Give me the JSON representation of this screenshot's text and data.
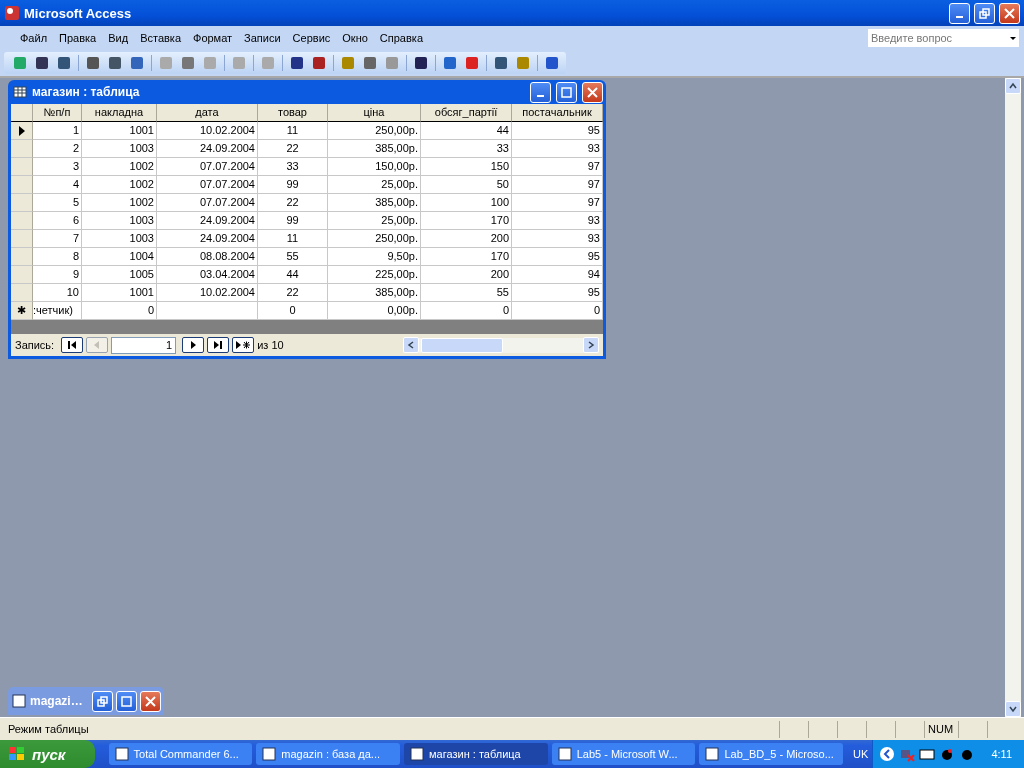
{
  "window": {
    "title": "Microsoft Access"
  },
  "menu": [
    {
      "label": "Файл"
    },
    {
      "label": "Правка"
    },
    {
      "label": "Вид"
    },
    {
      "label": "Вставка"
    },
    {
      "label": "Формат"
    },
    {
      "label": "Записи"
    },
    {
      "label": "Сервис"
    },
    {
      "label": "Окно"
    },
    {
      "label": "Справка"
    }
  ],
  "help_search": {
    "placeholder": "Введите вопрос"
  },
  "table_window": {
    "title": "магазин : таблица",
    "columns": [
      "№п/п",
      "накладна",
      "дата",
      "товар",
      "ціна",
      "обсяг_партії",
      "постачальник"
    ],
    "rows": [
      {
        "selected": true,
        "cells": [
          "1",
          "1001",
          "10.02.2004",
          "11",
          "250,00р.",
          "44",
          "95"
        ]
      },
      {
        "selected": false,
        "cells": [
          "2",
          "1003",
          "24.09.2004",
          "22",
          "385,00р.",
          "33",
          "93"
        ]
      },
      {
        "selected": false,
        "cells": [
          "3",
          "1002",
          "07.07.2004",
          "33",
          "150,00р.",
          "150",
          "97"
        ]
      },
      {
        "selected": false,
        "cells": [
          "4",
          "1002",
          "07.07.2004",
          "99",
          "25,00р.",
          "50",
          "97"
        ]
      },
      {
        "selected": false,
        "cells": [
          "5",
          "1002",
          "07.07.2004",
          "22",
          "385,00р.",
          "100",
          "97"
        ]
      },
      {
        "selected": false,
        "cells": [
          "6",
          "1003",
          "24.09.2004",
          "99",
          "25,00р.",
          "170",
          "93"
        ]
      },
      {
        "selected": false,
        "cells": [
          "7",
          "1003",
          "24.09.2004",
          "11",
          "250,00р.",
          "200",
          "93"
        ]
      },
      {
        "selected": false,
        "cells": [
          "8",
          "1004",
          "08.08.2004",
          "55",
          "9,50р.",
          "170",
          "95"
        ]
      },
      {
        "selected": false,
        "cells": [
          "9",
          "1005",
          "03.04.2004",
          "44",
          "225,00р.",
          "200",
          "94"
        ]
      },
      {
        "selected": false,
        "cells": [
          "10",
          "1001",
          "10.02.2004",
          "22",
          "385,00р.",
          "55",
          "95"
        ]
      }
    ],
    "new_row": {
      "marker": "✱",
      "cells": [
        ":четчик)",
        "0",
        null,
        "0",
        "0,00р.",
        "0",
        "0"
      ]
    },
    "navigator": {
      "label": "Запись:",
      "current": "1",
      "total": "из  10"
    }
  },
  "minimized_window": {
    "title": "magazi…"
  },
  "status_bar": {
    "text": "Режим таблицы",
    "num_indicator": "NUM"
  },
  "taskbar": {
    "start": "пуск",
    "tasks": [
      {
        "label": "Total Commander 6...",
        "selected": false
      },
      {
        "label": "magazin : база да...",
        "selected": false
      },
      {
        "label": "магазин : таблица",
        "selected": true
      },
      {
        "label": "Lab5 - Microsoft W...",
        "selected": false
      },
      {
        "label": "Lab_BD_5 - Microso...",
        "selected": false
      }
    ],
    "language": "UK",
    "clock": "4:11"
  }
}
